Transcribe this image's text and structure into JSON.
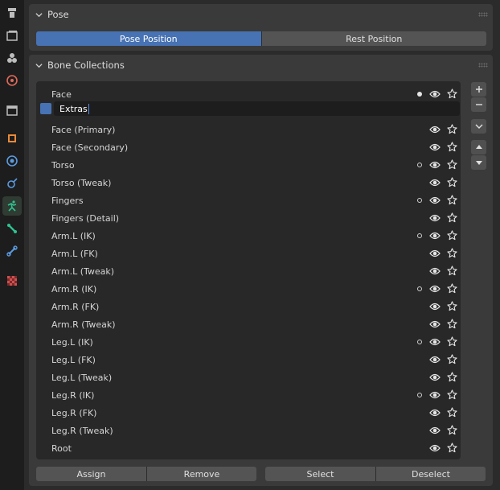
{
  "tab_icons": [
    "tool-icon",
    "render-icon",
    "output-icon",
    "view-layer-icon",
    "scene-icon",
    "world-icon",
    "collection-icon",
    "object-icon",
    "modifier-icon",
    "particles-icon",
    "physics-icon",
    "object-data-armature-icon",
    "bone-icon",
    "bone-constraint-icon",
    "texture-icon"
  ],
  "pose_panel": {
    "title": "Pose",
    "pose_position": "Pose Position",
    "rest_position": "Rest Position"
  },
  "bone_panel": {
    "title": "Bone Collections",
    "editing_value": "Extras",
    "rows": [
      {
        "name": "Face",
        "dot": "filled"
      },
      {
        "name": "Extras",
        "dot": "none",
        "editing": true
      },
      {
        "name": "Face (Primary)",
        "dot": "none"
      },
      {
        "name": "Face (Secondary)",
        "dot": "none"
      },
      {
        "name": "Torso",
        "dot": "hollow"
      },
      {
        "name": "Torso (Tweak)",
        "dot": "none"
      },
      {
        "name": "Fingers",
        "dot": "hollow"
      },
      {
        "name": "Fingers (Detail)",
        "dot": "none"
      },
      {
        "name": "Arm.L (IK)",
        "dot": "hollow"
      },
      {
        "name": "Arm.L (FK)",
        "dot": "none"
      },
      {
        "name": "Arm.L (Tweak)",
        "dot": "none"
      },
      {
        "name": "Arm.R (IK)",
        "dot": "hollow"
      },
      {
        "name": "Arm.R (FK)",
        "dot": "none"
      },
      {
        "name": "Arm.R (Tweak)",
        "dot": "none"
      },
      {
        "name": "Leg.L (IK)",
        "dot": "hollow"
      },
      {
        "name": "Leg.L (FK)",
        "dot": "none"
      },
      {
        "name": "Leg.L (Tweak)",
        "dot": "none"
      },
      {
        "name": "Leg.R (IK)",
        "dot": "hollow"
      },
      {
        "name": "Leg.R (FK)",
        "dot": "none"
      },
      {
        "name": "Leg.R (Tweak)",
        "dot": "none"
      },
      {
        "name": "Root",
        "dot": "none"
      }
    ],
    "buttons": {
      "assign": "Assign",
      "remove": "Remove",
      "select": "Select",
      "deselect": "Deselect"
    }
  },
  "colors": {
    "accent": "#4772b3",
    "active_tab_icon": "#2fc290"
  }
}
